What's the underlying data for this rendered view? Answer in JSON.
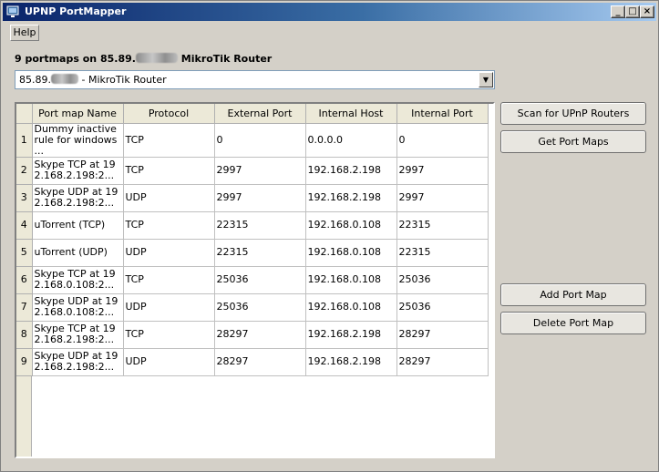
{
  "window": {
    "title": "UPNP PortMapper",
    "controls": [
      "_",
      "□",
      "×"
    ]
  },
  "menu": {
    "help": "Help"
  },
  "header": {
    "prefix": "9 portmaps on 85.89.",
    "suffix": "MikroTik Router"
  },
  "router_select": {
    "prefix": "85.89.",
    "suffix": " - MikroTik Router"
  },
  "table": {
    "columns": [
      "Port map Name",
      "Protocol",
      "External Port",
      "Internal Host",
      "Internal Port"
    ],
    "rows": [
      {
        "n": "1",
        "name": "Dummy inactive rule for windows ...",
        "protocol": "TCP",
        "ext": "0",
        "host": "0.0.0.0",
        "int": "0"
      },
      {
        "n": "2",
        "name": "Skype TCP at 192.168.2.198:2...",
        "protocol": "TCP",
        "ext": "2997",
        "host": "192.168.2.198",
        "int": "2997"
      },
      {
        "n": "3",
        "name": "Skype UDP at 192.168.2.198:2...",
        "protocol": "UDP",
        "ext": "2997",
        "host": "192.168.2.198",
        "int": "2997"
      },
      {
        "n": "4",
        "name": "uTorrent (TCP)",
        "protocol": "TCP",
        "ext": "22315",
        "host": "192.168.0.108",
        "int": "22315"
      },
      {
        "n": "5",
        "name": "uTorrent (UDP)",
        "protocol": "UDP",
        "ext": "22315",
        "host": "192.168.0.108",
        "int": "22315"
      },
      {
        "n": "6",
        "name": "Skype TCP at 192.168.0.108:2...",
        "protocol": "TCP",
        "ext": "25036",
        "host": "192.168.0.108",
        "int": "25036"
      },
      {
        "n": "7",
        "name": "Skype UDP at 192.168.0.108:2...",
        "protocol": "UDP",
        "ext": "25036",
        "host": "192.168.0.108",
        "int": "25036"
      },
      {
        "n": "8",
        "name": "Skype TCP at 192.168.2.198:2...",
        "protocol": "TCP",
        "ext": "28297",
        "host": "192.168.2.198",
        "int": "28297"
      },
      {
        "n": "9",
        "name": "Skype UDP at 192.168.2.198:2...",
        "protocol": "UDP",
        "ext": "28297",
        "host": "192.168.2.198",
        "int": "28297"
      }
    ]
  },
  "buttons": {
    "scan": "Scan for UPnP Routers",
    "get": "Get Port Maps",
    "add": "Add Port Map",
    "delete": "Delete Port Map"
  },
  "colors": {
    "title_gradient_start": "#0a246a",
    "title_gradient_end": "#a6caf0",
    "window_bg": "#d4d0c8"
  }
}
